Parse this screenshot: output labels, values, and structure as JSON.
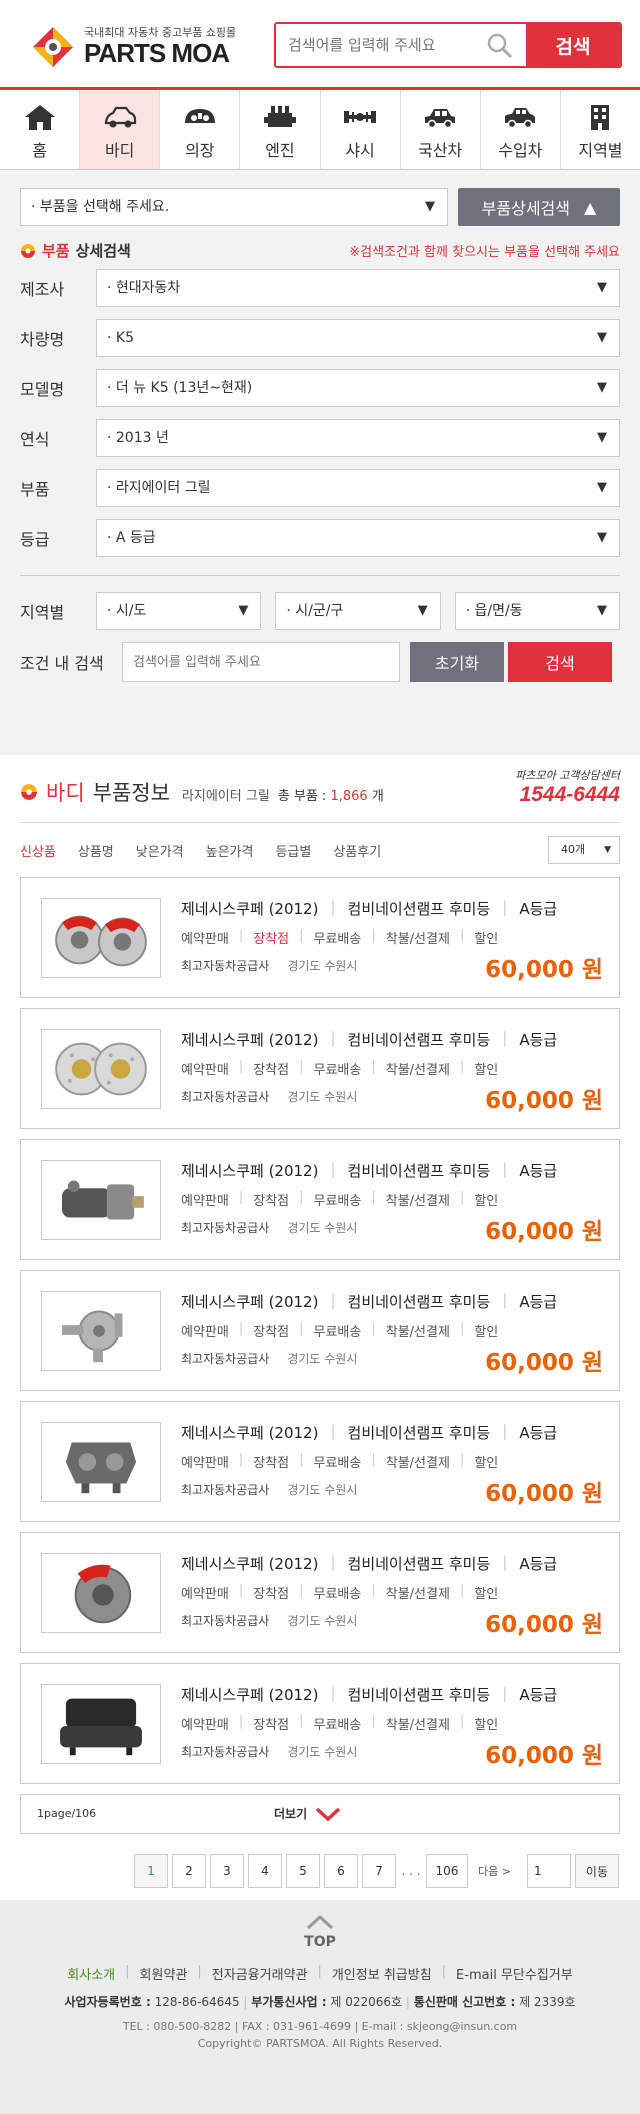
{
  "header": {
    "tagline": "국내최대 자동차 중고부품 쇼핑몰",
    "logo_text": "PARTS MOA",
    "search_placeholder": "검색어를 입력해 주세요",
    "search_button": "검색"
  },
  "nav": [
    {
      "label": "홈",
      "icon": "home-icon"
    },
    {
      "label": "바디",
      "icon": "car-body-icon",
      "active": true
    },
    {
      "label": "의장",
      "icon": "dashboard-icon"
    },
    {
      "label": "엔진",
      "icon": "engine-icon"
    },
    {
      "label": "샤시",
      "icon": "chassis-icon"
    },
    {
      "label": "국산차",
      "icon": "domestic-car-icon"
    },
    {
      "label": "수입차",
      "icon": "import-car-icon"
    },
    {
      "label": "지역별",
      "icon": "building-icon"
    }
  ],
  "filters": {
    "part_select": "· 부품을 선택해 주세요.",
    "detail_button": "부품상세검색",
    "detail_title_red": "부품",
    "detail_title": "상세검색",
    "detail_note": "※검색조건과 함께 찾으시는 부품을 선택해 주세요",
    "fields": [
      {
        "label": "제조사",
        "value": "· 현대자동차"
      },
      {
        "label": "차량명",
        "value": "· K5"
      },
      {
        "label": "모델명",
        "value": "· 더 뉴 K5 (13년~현재)"
      },
      {
        "label": "연식",
        "value": "· 2013 년"
      },
      {
        "label": "부품",
        "value": "· 라지에이터 그릴"
      },
      {
        "label": "등급",
        "value": "· A 등급"
      }
    ],
    "region_label": "지역별",
    "region_selects": [
      "· 시/도",
      "· 시/군/구",
      "· 읍/면/동"
    ],
    "cond_label": "조건 내 검색",
    "cond_placeholder": "검색어를 입력해 주세요",
    "reset_button": "초기화",
    "search_button": "검색"
  },
  "results": {
    "title_red": "바디",
    "title": "부품정보",
    "subtitle": "라지에이터 그릴",
    "count_label": "총 부품 :",
    "count": "1,866",
    "count_unit": "개",
    "cs_title": "파츠모아 고객상담센터",
    "cs_phone": "1544-6444",
    "tabs": [
      "신상품",
      "상품명",
      "낮은가격",
      "높은가격",
      "등급별",
      "상품후기"
    ],
    "per_page": "40개",
    "items": [
      {
        "thumb": "red-brake-calipers",
        "model": "제네시스쿠페 (2012)",
        "part": "컴비네이션램프 후미등",
        "grade": "A등급",
        "tags": [
          "예약판매",
          "장착점",
          "무료배송",
          "착불/선결제",
          "할인"
        ],
        "highlight": 1,
        "seller": "최고자동차공급사",
        "location": "경기도 수원시",
        "price": "60,000 원"
      },
      {
        "thumb": "brake-discs",
        "model": "제네시스쿠페 (2012)",
        "part": "컴비네이션램프 후미등",
        "grade": "A등급",
        "tags": [
          "예약판매",
          "장착점",
          "무료배송",
          "착불/선결제",
          "할인"
        ],
        "highlight": -1,
        "seller": "최고자동차공급사",
        "location": "경기도 수원시",
        "price": "60,000 원"
      },
      {
        "thumb": "starter-motor",
        "model": "제네시스쿠페 (2012)",
        "part": "컴비네이션램프 후미등",
        "grade": "A등급",
        "tags": [
          "예약판매",
          "장착점",
          "무료배송",
          "착불/선결제",
          "할인"
        ],
        "highlight": -1,
        "seller": "최고자동차공급사",
        "location": "경기도 수원시",
        "price": "60,000 원"
      },
      {
        "thumb": "water-pump",
        "model": "제네시스쿠페 (2012)",
        "part": "컴비네이션램프 후미등",
        "grade": "A등급",
        "tags": [
          "예약판매",
          "장착점",
          "무료배송",
          "착불/선결제",
          "할인"
        ],
        "highlight": -1,
        "seller": "최고자동차공급사",
        "location": "경기도 수원시",
        "price": "60,000 원"
      },
      {
        "thumb": "brake-caliper",
        "model": "제네시스쿠페 (2012)",
        "part": "컴비네이션램프 후미등",
        "grade": "A등급",
        "tags": [
          "예약판매",
          "장착점",
          "무료배송",
          "착불/선결제",
          "할인"
        ],
        "highlight": -1,
        "seller": "최고자동차공급사",
        "location": "경기도 수원시",
        "price": "60,000 원"
      },
      {
        "thumb": "disc-with-red-caliper",
        "model": "제네시스쿠페 (2012)",
        "part": "컴비네이션램프 후미등",
        "grade": "A등급",
        "tags": [
          "예약판매",
          "장착점",
          "무료배송",
          "착불/선결제",
          "할인"
        ],
        "highlight": -1,
        "seller": "최고자동차공급사",
        "location": "경기도 수원시",
        "price": "60,000 원"
      },
      {
        "thumb": "car-seat",
        "model": "제네시스쿠페 (2012)",
        "part": "컴비네이션램프 후미등",
        "grade": "A등급",
        "tags": [
          "예약판매",
          "장착점",
          "무료배송",
          "착불/선결제",
          "할인"
        ],
        "highlight": -1,
        "seller": "최고자동차공급사",
        "location": "경기도 수원시",
        "price": "60,000 원"
      }
    ],
    "page_info": "1page/106",
    "more_label": "더보기"
  },
  "pagination": {
    "pages": [
      "1",
      "2",
      "3",
      "4",
      "5",
      "6",
      "7"
    ],
    "current": "1",
    "ellipsis": ". . .",
    "last": "106",
    "next_label": "다음 >",
    "input_value": "1",
    "go_label": "이동"
  },
  "footer": {
    "top_label": "TOP",
    "links": [
      "회사소개",
      "회원약관",
      "전자금융거래약관",
      "개인정보 취급방침",
      "E-mail 무단수집거부"
    ],
    "biz": [
      {
        "label": "사업자등록번호 :",
        "value": "128-86-64645"
      },
      {
        "label": "부가통신사업 :",
        "value": "제 022066호"
      },
      {
        "label": "통신판매 신고번호 :",
        "value": "제 2339호"
      }
    ],
    "contact": "TEL : 080-500-8282  |  FAX : 031-961-4699  |  E-mail : skjeong@insun.com",
    "copyright": "Copyright© PARTSMOA. All Rights Reserved."
  },
  "colors": {
    "brand_red": "#e0313c",
    "price_orange": "#e8620c",
    "button_gray": "#6f727c"
  }
}
